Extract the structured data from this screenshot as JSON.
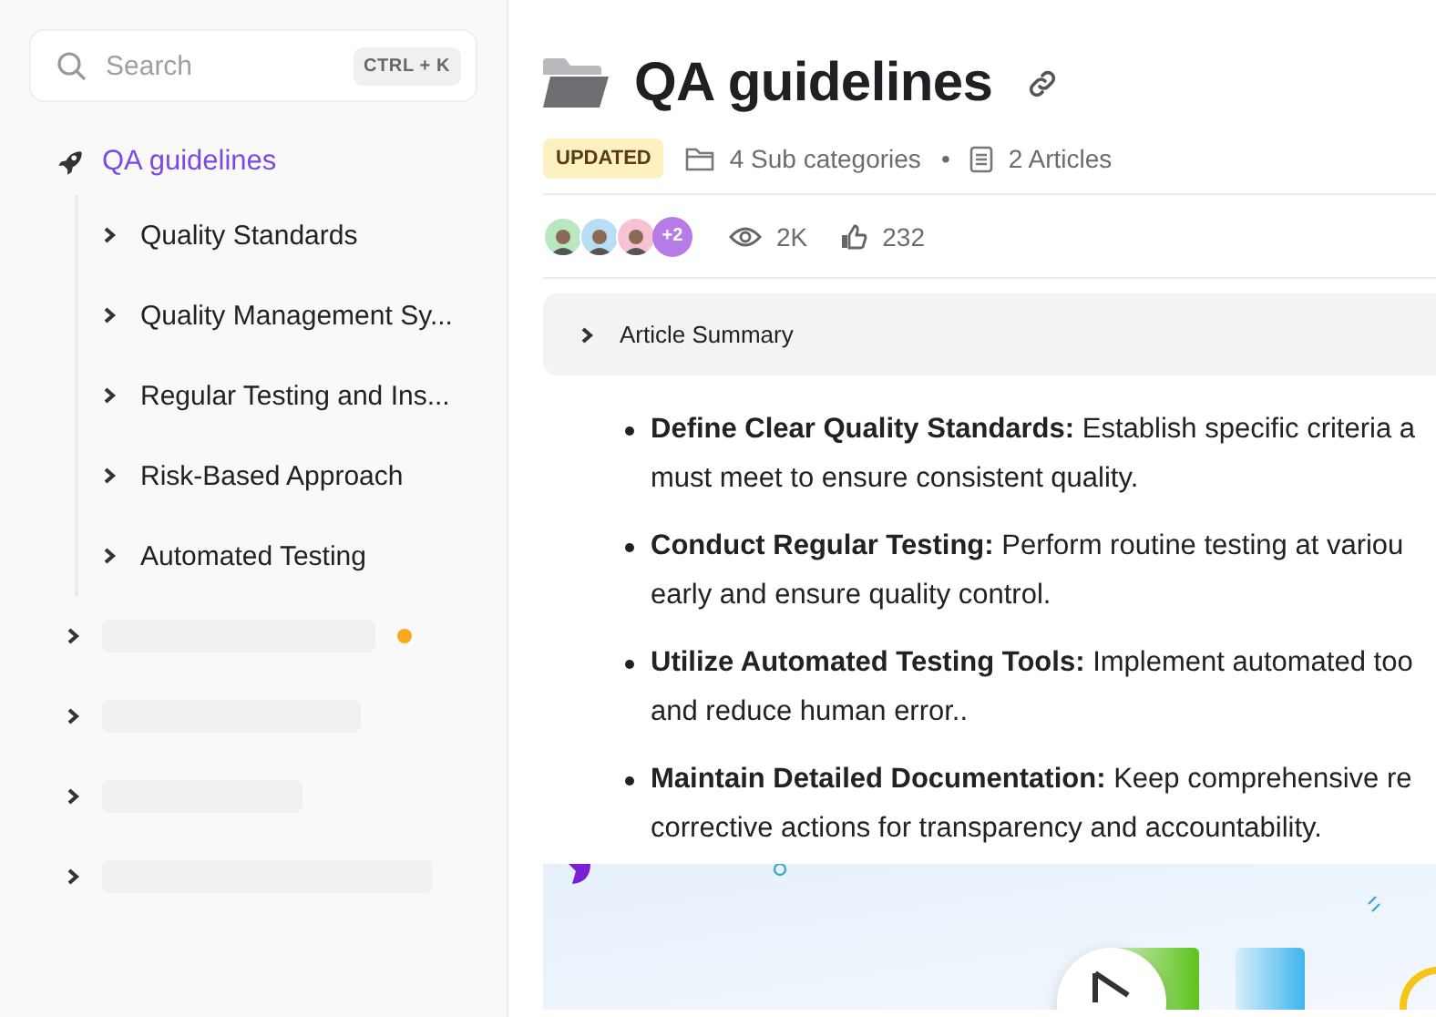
{
  "search": {
    "placeholder": "Search",
    "shortcut": "CTRL + K"
  },
  "sidebar": {
    "root": {
      "label": "QA guidelines",
      "selected": true,
      "children": [
        {
          "label": "Quality Standards",
          "expanded": false
        },
        {
          "label": "Quality Management Sy...",
          "expanded": false
        },
        {
          "label": "Regular Testing and Ins...",
          "expanded": false
        },
        {
          "label": "Risk-Based Approach",
          "expanded": false
        },
        {
          "label": "Automated Testing",
          "expanded": false
        }
      ]
    },
    "loading_items": [
      {
        "unread": true
      },
      {
        "unread": false
      },
      {
        "unread": false
      },
      {
        "unread": false
      }
    ]
  },
  "header": {
    "title": "QA guidelines",
    "badge": "UPDATED",
    "subcategories": "4 Sub categories",
    "separator": "•",
    "articles": "2 Articles"
  },
  "stats": {
    "avatars": [
      {
        "color": "#b9e8c0"
      },
      {
        "color": "#b8def5"
      },
      {
        "color": "#f7c3d3"
      }
    ],
    "more": "+2",
    "views": "2K",
    "likes": "232"
  },
  "summary": {
    "label": "Article Summary",
    "expanded": false
  },
  "bullets": [
    {
      "title": "Define Clear Quality Standards:",
      "text": "Establish specific criteria a",
      "continuation": "must meet to ensure consistent quality."
    },
    {
      "title": "Conduct Regular Testing:",
      "text": "Perform routine testing at variou",
      "continuation": "early and ensure quality control."
    },
    {
      "title": "Utilize Automated Testing Tools:",
      "text": "Implement automated too",
      "continuation": "and reduce human error.."
    },
    {
      "title": "Maintain Detailed Documentation:",
      "text": "Keep comprehensive re",
      "continuation": "corrective actions for transparency and accountability."
    }
  ]
}
